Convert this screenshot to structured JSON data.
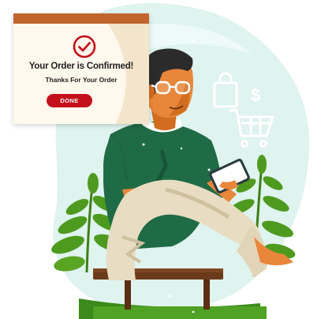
{
  "dialog": {
    "title": "Your Order is Confirmed!",
    "subtitle": "Thanks For Your Order",
    "button_label": "DONE"
  },
  "icons": {
    "dollar": "$",
    "shopping_bag": "shopping-bag-icon",
    "cart": "shopping-cart-icon",
    "check": "check-circle-icon"
  },
  "colors": {
    "accent_red": "#c4101a",
    "dialog_bar": "#c1652d",
    "shirt_green": "#1f6b45",
    "mint_blob": "#dff3ef",
    "skin": "#e8863a",
    "pants": "#e8dcc2"
  }
}
